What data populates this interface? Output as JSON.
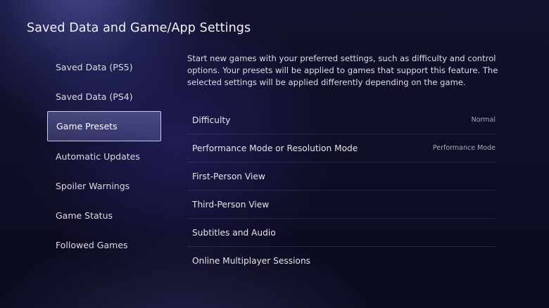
{
  "header": {
    "title": "Saved Data and Game/App Settings"
  },
  "sidebar": {
    "items": [
      {
        "label": "Saved Data (PS5)"
      },
      {
        "label": "Saved Data (PS4)"
      },
      {
        "label": "Game Presets",
        "selected": true
      },
      {
        "label": "Automatic Updates"
      },
      {
        "label": "Spoiler Warnings"
      },
      {
        "label": "Game Status"
      },
      {
        "label": "Followed Games"
      }
    ]
  },
  "main": {
    "description": "Start new games with your preferred settings, such as difficulty and control options. Your presets will be applied to games that support this feature. The selected settings will be applied differently depending on the game.",
    "settings": [
      {
        "label": "Difficulty",
        "value": "Normal"
      },
      {
        "label": "Performance Mode or Resolution Mode",
        "value": "Performance Mode"
      },
      {
        "label": "First-Person View",
        "value": ""
      },
      {
        "label": "Third-Person View",
        "value": ""
      },
      {
        "label": "Subtitles and Audio",
        "value": ""
      },
      {
        "label": "Online Multiplayer Sessions",
        "value": ""
      }
    ]
  },
  "colors": {
    "background": "#0e0e26",
    "selection": "#6e6eaf",
    "selection_border": "#c9cbe6"
  }
}
